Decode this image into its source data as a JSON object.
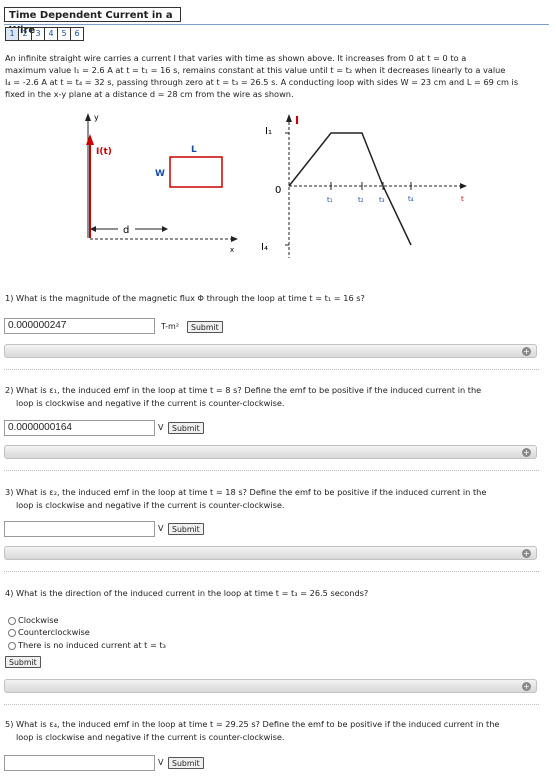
{
  "title": "Time Dependent Current in a Wire",
  "tabs": [
    "1",
    "2",
    "3",
    "4",
    "5",
    "6"
  ],
  "intro": {
    "line1": "An infinite straight wire carries a current I that varies with time as shown above. It increases from 0 at t = 0 to a",
    "line2": "maximum value I₁ = 2.6 A at t = t₁ = 16 s, remains constant at this value until t = t₂ when it decreases linearly to a value",
    "line3": "I₄ = -2.6 A at t = t₄ = 32 s, passing through zero at t = t₃ = 26.5 s. A conducting loop with sides W = 23 cm and L = 69 cm is",
    "line4": "fixed in the x-y plane at a distance d = 28 cm from the wire as shown."
  },
  "figure": {
    "y_label": "y",
    "current_label": "I(t)",
    "L_label": "L",
    "W_label": "W",
    "d_label": "d",
    "x_label": "x",
    "graph_I_label": "I",
    "I1_label": "I₁",
    "I4_label": "I₄",
    "zero_label": "0",
    "t1": "t₁",
    "t2": "t₂",
    "t3": "t₃",
    "t4": "t₄",
    "t": "t"
  },
  "questions": [
    {
      "line1": "1) What is the magnitude of the magnetic flux Φ through the loop at time t = t₁ = 16 s?",
      "line2": "",
      "value": "0.000000247",
      "unit": "T-m²",
      "submit": "Submit"
    },
    {
      "line1": "2) What is ε₁, the induced emf in the loop at time t = 8 s? Define the emf to be positive if the induced current in the",
      "line2": "loop is clockwise and negative if the current is counter-clockwise.",
      "value": "0.0000000164",
      "unit": "V",
      "submit": "Submit"
    },
    {
      "line1": "3) What is ε₂, the induced emf in the loop at time t = 18 s? Define the emf to be positive if the induced current in the",
      "line2": "loop is clockwise and negative if the current is counter-clockwise.",
      "value": "",
      "unit": "V",
      "submit": "Submit"
    },
    {
      "line1": "4) What is the direction of the induced current in the loop at time t = t₃ = 26.5 seconds?",
      "options": [
        "Clockwise",
        "Counterclockwise",
        "There is no induced current at t = t₃"
      ],
      "submit": "Submit"
    },
    {
      "line1": "5) What is ε₄, the induced emf in the loop at time t = 29.25 s? Define the emf to be positive if the induced current in the",
      "line2": "loop is clockwise and negative if the current is counter-clockwise.",
      "value": "",
      "unit": "V",
      "submit": "Submit"
    }
  ],
  "hint_icon": "plus-circle-icon",
  "colors": {
    "wire": "#cc0000",
    "loop": "#cc0000",
    "graph_I": "#cc0000",
    "tab_link": "#1a4fa0",
    "rule": "#7a9cc8"
  }
}
